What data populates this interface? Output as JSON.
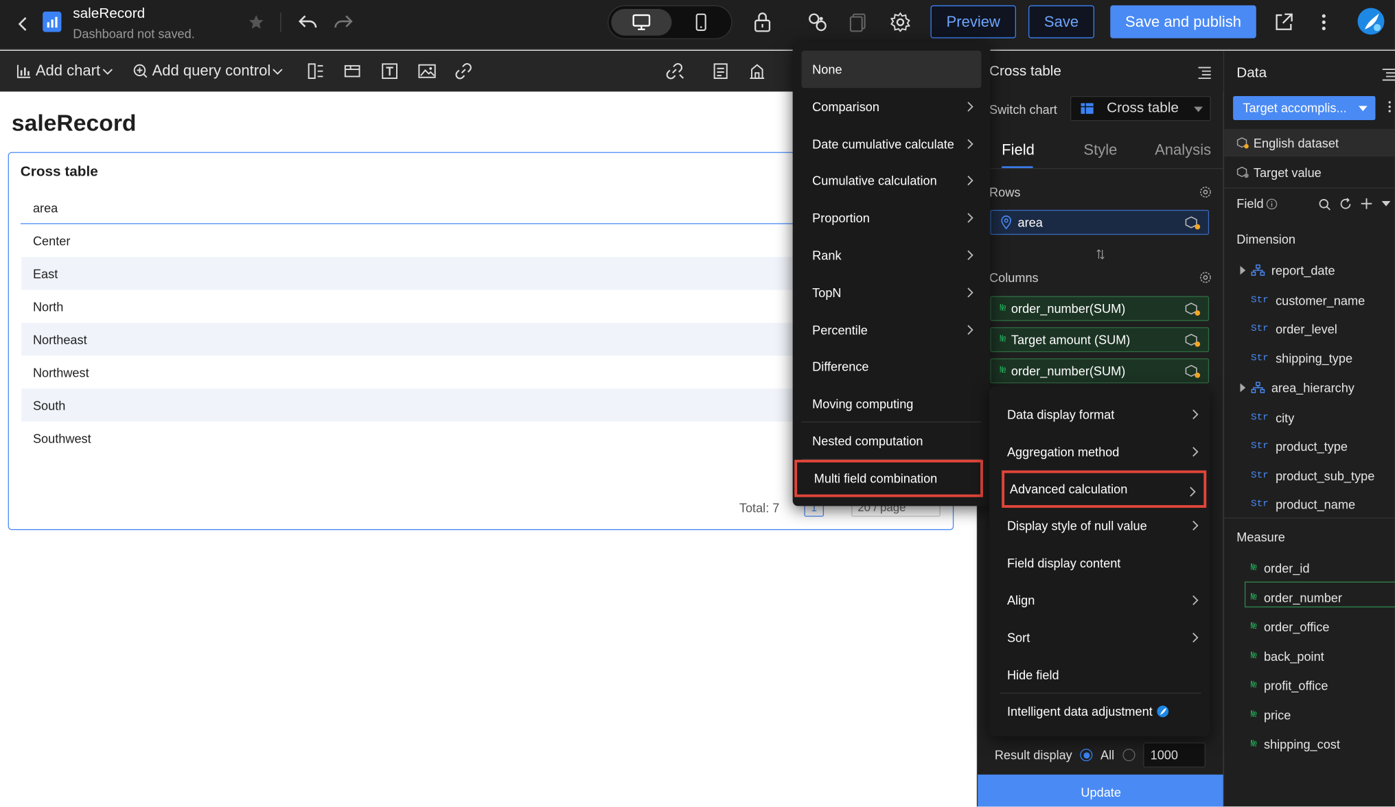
{
  "header": {
    "title": "saleRecord",
    "subtitle": "Dashboard not saved.",
    "preview_label": "Preview",
    "save_label": "Save",
    "save_publish_label": "Save and publish"
  },
  "toolbar": {
    "add_chart_label": "Add chart",
    "add_query_label": "Add query control"
  },
  "canvas": {
    "page_title": "saleRecord",
    "card_title": "Cross table",
    "column_header": "area",
    "rows": [
      "Center",
      "East",
      "North",
      "Northeast",
      "Northwest",
      "South",
      "Southwest"
    ],
    "total_label": "Total: 7",
    "current_page": "1",
    "page_size": "20 / page"
  },
  "menu_left": {
    "items": [
      {
        "label": "None",
        "has_sub": false
      },
      {
        "label": "Comparison",
        "has_sub": true
      },
      {
        "label": "Date cumulative calculate",
        "has_sub": true
      },
      {
        "label": "Cumulative calculation",
        "has_sub": true
      },
      {
        "label": "Proportion",
        "has_sub": true
      },
      {
        "label": "Rank",
        "has_sub": true
      },
      {
        "label": "TopN",
        "has_sub": true
      },
      {
        "label": "Percentile",
        "has_sub": true
      },
      {
        "label": "Difference",
        "has_sub": false
      },
      {
        "label": "Moving computing",
        "has_sub": false
      },
      {
        "label": "Nested computation",
        "has_sub": false
      },
      {
        "label": "Multi field combination",
        "has_sub": false
      }
    ]
  },
  "menu_right": {
    "items": [
      {
        "label": "Data display format",
        "has_sub": true
      },
      {
        "label": "Aggregation method",
        "has_sub": true
      },
      {
        "label": "Advanced calculation",
        "has_sub": true
      },
      {
        "label": "Display style of null value",
        "has_sub": true
      },
      {
        "label": "Field display content",
        "has_sub": false
      },
      {
        "label": "Align",
        "has_sub": true
      },
      {
        "label": "Sort",
        "has_sub": true
      },
      {
        "label": "Hide field",
        "has_sub": false
      },
      {
        "label": "Intelligent data adjustment",
        "has_sub": false
      }
    ]
  },
  "config_panel": {
    "title": "Cross table",
    "switch_chart_label": "Switch chart",
    "chart_type": "Cross table",
    "tabs": [
      "Field",
      "Style",
      "Analysis"
    ],
    "rows_label": "Rows",
    "row_fields": [
      "area"
    ],
    "columns_label": "Columns",
    "column_fields": [
      "order_number(SUM)",
      "Target amount (SUM)",
      "order_number(SUM)"
    ],
    "result_display_label": "Result display",
    "result_all_label": "All",
    "result_limit": "1000",
    "update_label": "Update"
  },
  "data_panel": {
    "title": "Data",
    "dataset_select": "Target accomplis...",
    "datasets": [
      "English dataset",
      "Target value"
    ],
    "field_label": "Field",
    "dimension_label": "Dimension",
    "dimensions": [
      {
        "name": "report_date",
        "type": "hier"
      },
      {
        "name": "customer_name",
        "type": "Str"
      },
      {
        "name": "order_level",
        "type": "Str"
      },
      {
        "name": "shipping_type",
        "type": "Str"
      },
      {
        "name": "area_hierarchy",
        "type": "hier"
      },
      {
        "name": "city",
        "type": "Str"
      },
      {
        "name": "product_type",
        "type": "Str"
      },
      {
        "name": "product_sub_type",
        "type": "Str"
      },
      {
        "name": "product_name",
        "type": "Str"
      }
    ],
    "measure_label": "Measure",
    "measures": [
      "order_id",
      "order_number",
      "order_office",
      "back_point",
      "profit_office",
      "price",
      "shipping_cost"
    ]
  },
  "colors": {
    "accent": "#3b82f6",
    "highlight_border": "#e0453a",
    "measure_green": "#21b35b",
    "dark_bg": "#1f1f1f"
  }
}
